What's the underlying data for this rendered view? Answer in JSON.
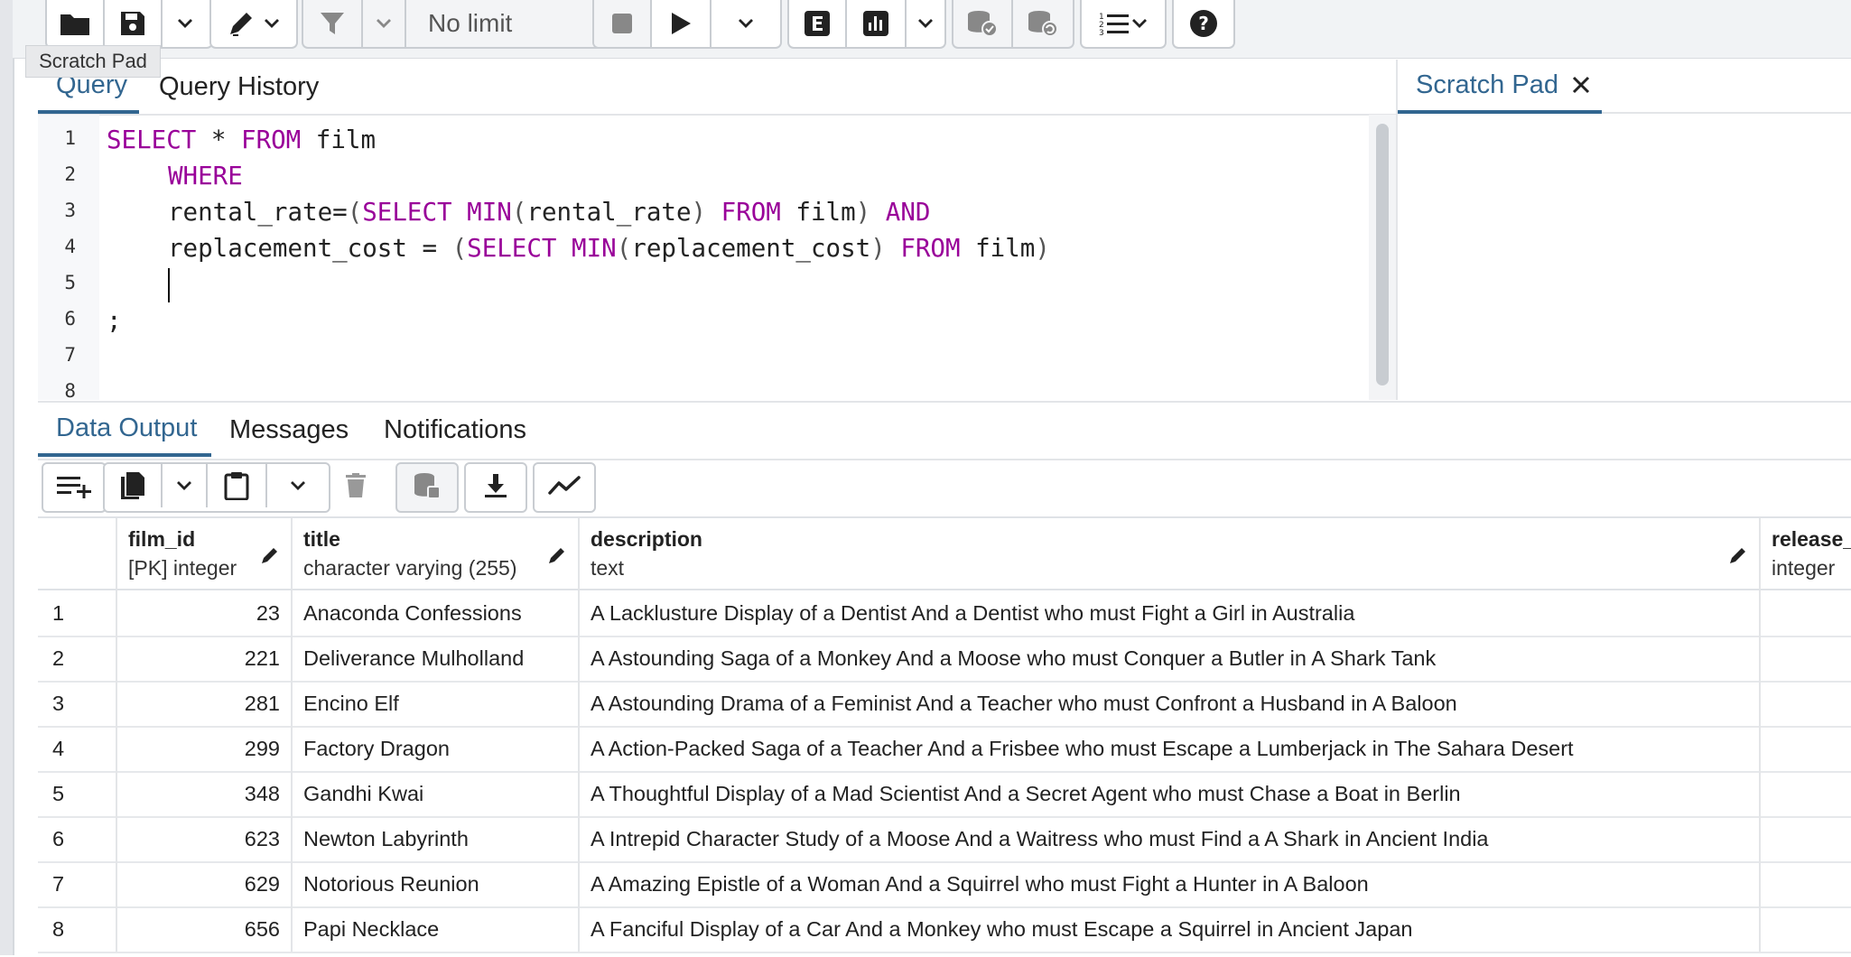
{
  "toolbar": {
    "limit_value": "No limit",
    "tooltip": "Scratch Pad"
  },
  "editor": {
    "tabs": [
      "Query",
      "Query History"
    ],
    "scratch_tab": "Scratch Pad",
    "line_numbers": [
      "1",
      "2",
      "3",
      "4",
      "5",
      "6",
      "7",
      "8"
    ],
    "code": {
      "l1": {
        "kw1": "SELECT",
        "t1": " * ",
        "kw2": "FROM",
        "t2": " film"
      },
      "l2": {
        "kw1": "WHERE"
      },
      "l3": {
        "t1": "rental_rate=",
        "p1": "(",
        "kw1": "SELECT",
        "sp1": " ",
        "kw2": "MIN",
        "p2": "(",
        "t2": "rental_rate",
        "p3": ")",
        "sp2": " ",
        "kw3": "FROM",
        "t3": " film",
        "p4": ")",
        "sp3": " ",
        "kw4": "AND"
      },
      "l4": {
        "t1": "replacement_cost = ",
        "p1": "(",
        "kw1": "SELECT",
        "sp1": " ",
        "kw2": "MIN",
        "p2": "(",
        "t2": "replacement_cost",
        "p3": ")",
        "sp2": " ",
        "kw3": "FROM",
        "t3": " film",
        "p4": ")"
      },
      "l6": {
        "t1": ";"
      }
    }
  },
  "results": {
    "tabs": [
      "Data Output",
      "Messages",
      "Notifications"
    ],
    "columns": [
      {
        "name": "film_id",
        "type": "[PK] integer"
      },
      {
        "name": "title",
        "type": "character varying (255)"
      },
      {
        "name": "description",
        "type": "text"
      },
      {
        "name": "release_",
        "type": "integer"
      }
    ],
    "rows": [
      {
        "n": "1",
        "id": "23",
        "title": "Anaconda Confessions",
        "desc": "A Lacklusture Display of a Dentist And a Dentist who must Fight a Girl in Australia"
      },
      {
        "n": "2",
        "id": "221",
        "title": "Deliverance Mulholland",
        "desc": "A Astounding Saga of a Monkey And a Moose who must Conquer a Butler in A Shark Tank"
      },
      {
        "n": "3",
        "id": "281",
        "title": "Encino Elf",
        "desc": "A Astounding Drama of a Feminist And a Teacher who must Confront a Husband in A Baloon"
      },
      {
        "n": "4",
        "id": "299",
        "title": "Factory Dragon",
        "desc": "A Action-Packed Saga of a Teacher And a Frisbee who must Escape a Lumberjack in The Sahara Desert"
      },
      {
        "n": "5",
        "id": "348",
        "title": "Gandhi Kwai",
        "desc": "A Thoughtful Display of a Mad Scientist And a Secret Agent who must Chase a Boat in Berlin"
      },
      {
        "n": "6",
        "id": "623",
        "title": "Newton Labyrinth",
        "desc": "A Intrepid Character Study of a Moose And a Waitress who must Find a A Shark in Ancient India"
      },
      {
        "n": "7",
        "id": "629",
        "title": "Notorious Reunion",
        "desc": "A Amazing Epistle of a Woman And a Squirrel who must Fight a Hunter in A Baloon"
      },
      {
        "n": "8",
        "id": "656",
        "title": "Papi Necklace",
        "desc": "A Fanciful Display of a Car And a Monkey who must Escape a Squirrel in Ancient Japan"
      }
    ]
  },
  "colors": {
    "accent": "#326690",
    "keyword": "#990099"
  },
  "icons": [
    "folder-icon",
    "save-icon",
    "chevron-down-icon",
    "pencil-icon",
    "filter-icon",
    "stop-icon",
    "play-icon",
    "explain-icon",
    "explain-analyze-icon",
    "commit-icon",
    "rollback-icon",
    "macros-icon",
    "help-icon",
    "close-icon",
    "add-row-icon",
    "copy-icon",
    "paste-icon",
    "delete-icon",
    "save-data-icon",
    "download-icon",
    "graph-icon",
    "edit-column-icon"
  ]
}
